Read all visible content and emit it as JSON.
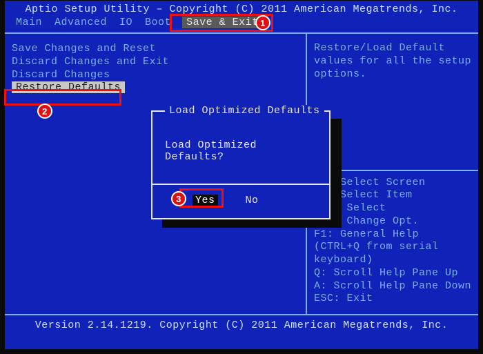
{
  "header": {
    "title": "Aptio Setup Utility – Copyright (C) 2011 American Megatrends, Inc."
  },
  "menubar": {
    "tabs": [
      "Main",
      "Advanced",
      "IO",
      "Boot",
      "Save & Exit"
    ],
    "selected": 4
  },
  "left": {
    "items": [
      "Save Changes and Reset",
      "Discard Changes and Exit",
      "Discard Changes",
      "Restore Defaults"
    ],
    "selected": 3
  },
  "right": {
    "help": "Restore/Load Default values for all the setup options.",
    "keys": [
      "  : Select Screen",
      "  : Select Item",
      "ter: Select",
      "+/-: Change Opt.",
      "F1: General Help",
      "(CTRL+Q from serial",
      "keyboard)",
      "Q: Scroll Help Pane Up",
      "A: Scroll Help Pane Down",
      "ESC: Exit"
    ]
  },
  "dialog": {
    "title": "Load Optimized Defaults",
    "message": "Load Optimized Defaults?",
    "yes": "Yes",
    "no": "No"
  },
  "footer": {
    "text": "Version 2.14.1219. Copyright (C) 2011 American Megatrends, Inc."
  },
  "annotations": {
    "b1": "1",
    "b2": "2",
    "b3": "3"
  }
}
